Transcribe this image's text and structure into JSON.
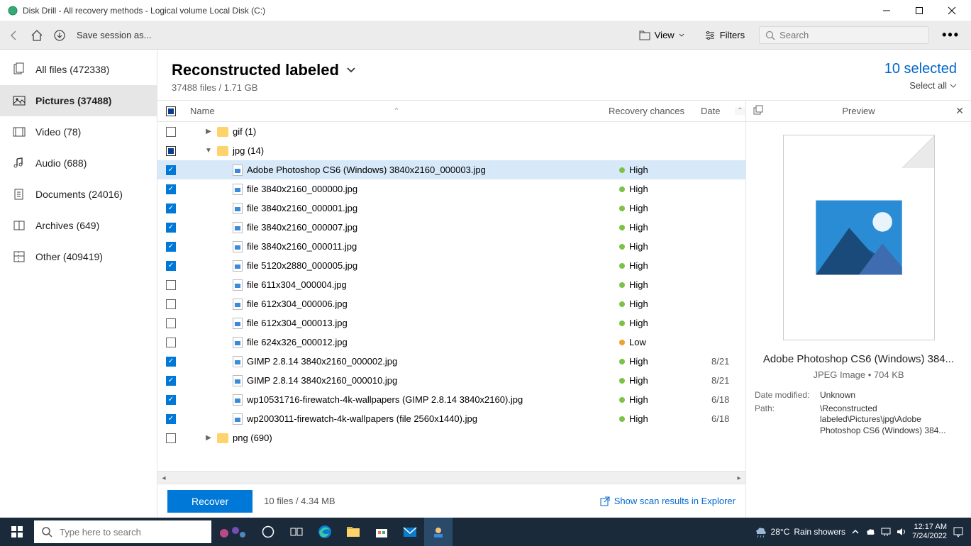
{
  "window": {
    "title": "Disk Drill - All recovery methods - Logical volume Local Disk (C:)"
  },
  "toolbar": {
    "save_session": "Save session as...",
    "view": "View",
    "filters": "Filters",
    "search_placeholder": "Search"
  },
  "sidebar": {
    "items": [
      {
        "label": "All files (472338)"
      },
      {
        "label": "Pictures (37488)"
      },
      {
        "label": "Video (78)"
      },
      {
        "label": "Audio (688)"
      },
      {
        "label": "Documents (24016)"
      },
      {
        "label": "Archives (649)"
      },
      {
        "label": "Other (409419)"
      }
    ]
  },
  "content_header": {
    "title": "Reconstructed labeled",
    "subtitle": "37488 files / 1.71 GB",
    "selected": "10 selected",
    "select_all": "Select all"
  },
  "columns": {
    "name": "Name",
    "recovery": "Recovery chances",
    "date": "Date"
  },
  "rows": [
    {
      "indent": 1,
      "arrow": "▶",
      "type": "folder",
      "name": "gif (1)",
      "check": "empty"
    },
    {
      "indent": 1,
      "arrow": "▼",
      "type": "folder",
      "name": "jpg (14)",
      "check": "mixed"
    },
    {
      "indent": 2,
      "type": "file",
      "name": "Adobe Photoshop CS6 (Windows) 3840x2160_000003.jpg",
      "rec": "High",
      "dot": "high",
      "check": "checked",
      "selected": true
    },
    {
      "indent": 2,
      "type": "file",
      "name": "file 3840x2160_000000.jpg",
      "rec": "High",
      "dot": "high",
      "check": "checked"
    },
    {
      "indent": 2,
      "type": "file",
      "name": "file 3840x2160_000001.jpg",
      "rec": "High",
      "dot": "high",
      "check": "checked"
    },
    {
      "indent": 2,
      "type": "file",
      "name": "file 3840x2160_000007.jpg",
      "rec": "High",
      "dot": "high",
      "check": "checked"
    },
    {
      "indent": 2,
      "type": "file",
      "name": "file 3840x2160_000011.jpg",
      "rec": "High",
      "dot": "high",
      "check": "checked"
    },
    {
      "indent": 2,
      "type": "file",
      "name": "file 5120x2880_000005.jpg",
      "rec": "High",
      "dot": "high",
      "check": "checked"
    },
    {
      "indent": 2,
      "type": "file",
      "name": "file 611x304_000004.jpg",
      "rec": "High",
      "dot": "high",
      "check": "empty"
    },
    {
      "indent": 2,
      "type": "file",
      "name": "file 612x304_000006.jpg",
      "rec": "High",
      "dot": "high",
      "check": "empty"
    },
    {
      "indent": 2,
      "type": "file",
      "name": "file 612x304_000013.jpg",
      "rec": "High",
      "dot": "high",
      "check": "empty"
    },
    {
      "indent": 2,
      "type": "file",
      "name": "file 624x326_000012.jpg",
      "rec": "Low",
      "dot": "low",
      "check": "empty"
    },
    {
      "indent": 2,
      "type": "file",
      "name": "GIMP 2.8.14 3840x2160_000002.jpg",
      "rec": "High",
      "dot": "high",
      "check": "checked",
      "date": "8/21"
    },
    {
      "indent": 2,
      "type": "file",
      "name": "GIMP 2.8.14 3840x2160_000010.jpg",
      "rec": "High",
      "dot": "high",
      "check": "checked",
      "date": "8/21"
    },
    {
      "indent": 2,
      "type": "file",
      "name": "wp10531716-firewatch-4k-wallpapers (GIMP 2.8.14 3840x2160).jpg",
      "rec": "High",
      "dot": "high",
      "check": "checked",
      "date": "6/18"
    },
    {
      "indent": 2,
      "type": "file",
      "name": "wp2003011-firewatch-4k-wallpapers (file 2560x1440).jpg",
      "rec": "High",
      "dot": "high",
      "check": "checked",
      "date": "6/18"
    },
    {
      "indent": 1,
      "arrow": "▶",
      "type": "folder",
      "name": "png (690)",
      "check": "empty"
    }
  ],
  "preview": {
    "title": "Preview",
    "filename": "Adobe Photoshop CS6 (Windows) 384...",
    "typesize": "JPEG Image • 704 KB",
    "modified_label": "Date modified:",
    "modified_value": "Unknown",
    "path_label": "Path:",
    "path_value": "\\Reconstructed labeled\\Pictures\\jpg\\Adobe Photoshop CS6 (Windows) 384..."
  },
  "footer": {
    "recover": "Recover",
    "stats": "10 files / 4.34 MB",
    "show_link": "Show scan results in Explorer"
  },
  "taskbar": {
    "search_placeholder": "Type here to search",
    "weather_temp": "28°C",
    "weather_desc": "Rain showers",
    "time": "12:17 AM",
    "date": "7/24/2022"
  }
}
